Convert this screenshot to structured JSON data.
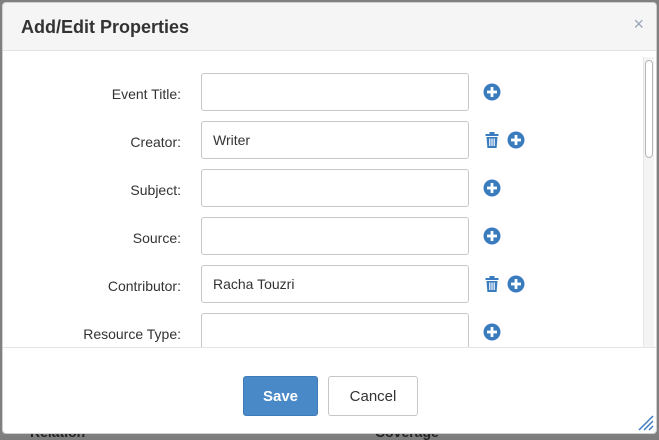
{
  "dialog": {
    "title": "Add/Edit Properties",
    "close_glyph": "×"
  },
  "background": {
    "left_label": "Relation",
    "right_label": "Coverage"
  },
  "fields": [
    {
      "label": "Event Title:",
      "value": "",
      "has_delete": false
    },
    {
      "label": "Creator:",
      "value": "Writer",
      "has_delete": true
    },
    {
      "label": "Subject:",
      "value": "",
      "has_delete": false
    },
    {
      "label": "Source:",
      "value": "",
      "has_delete": false
    },
    {
      "label": "Contributor:",
      "value": "Racha Touzri",
      "has_delete": true
    },
    {
      "label": "Resource Type:",
      "value": "",
      "has_delete": false
    }
  ],
  "buttons": {
    "save": "Save",
    "cancel": "Cancel"
  },
  "icons": {
    "add": "plus-circle-icon",
    "delete": "trash-icon",
    "close": "close-icon",
    "resize": "resize-grip-icon"
  },
  "colors": {
    "accent": "#4a89c8",
    "icon_blue": "#3a7bc0"
  }
}
